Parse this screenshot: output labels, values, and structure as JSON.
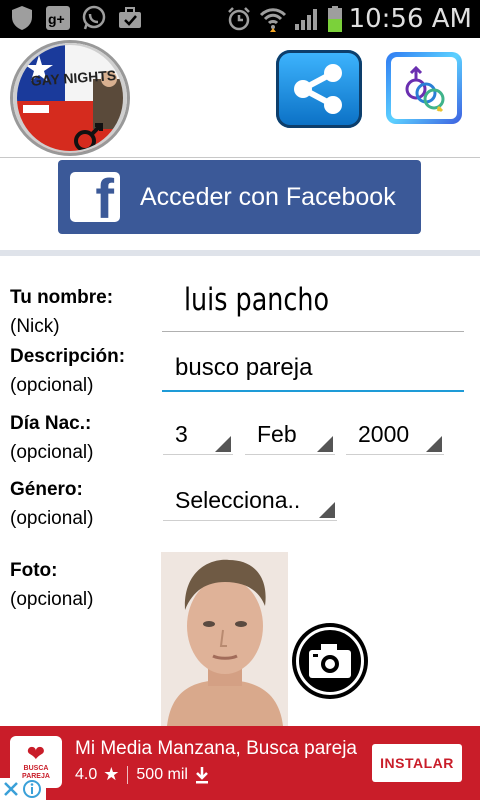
{
  "status_bar": {
    "time": "10:56 AM",
    "icons": [
      "shield-icon",
      "google-plus-icon",
      "whatsapp-icon",
      "briefcase-icon",
      "alarm-icon",
      "wifi-icon",
      "signal-icon",
      "battery-icon"
    ],
    "colors": {
      "background": "#000000",
      "icon": "#bdbdbd",
      "battery": "#7bd13a"
    }
  },
  "header": {
    "logo_text": "GAY NIGHTS",
    "share_icon": "share-icon",
    "gender_icon": "gender-symbols-icon"
  },
  "facebook": {
    "label": "Acceder con Facebook",
    "logo_letter": "f",
    "color": "#3b5998"
  },
  "form": {
    "name": {
      "label": "Tu nombre:",
      "sublabel": "(Nick)",
      "value": "luis pancho"
    },
    "description": {
      "label": "Descripción:",
      "sublabel": "(opcional)",
      "value": "busco pareja"
    },
    "birth": {
      "label": "Día Nac.:",
      "sublabel": "(opcional)",
      "day": "3",
      "month": "Feb",
      "year": "2000"
    },
    "gender": {
      "label": "Género:",
      "sublabel": "(opcional)",
      "value": "Selecciona.."
    },
    "photo": {
      "label": "Foto:",
      "sublabel": "(opcional)",
      "camera_icon": "camera-icon"
    },
    "accent_color": "#1e9bd7"
  },
  "ad": {
    "title": "Mi Media Manzana, Busca pareja",
    "rating": "4.0",
    "downloads": "500 mil",
    "install_label": "INSTALAR",
    "icon_text": "BUSCA PAREJA",
    "color": "#c91d29"
  }
}
